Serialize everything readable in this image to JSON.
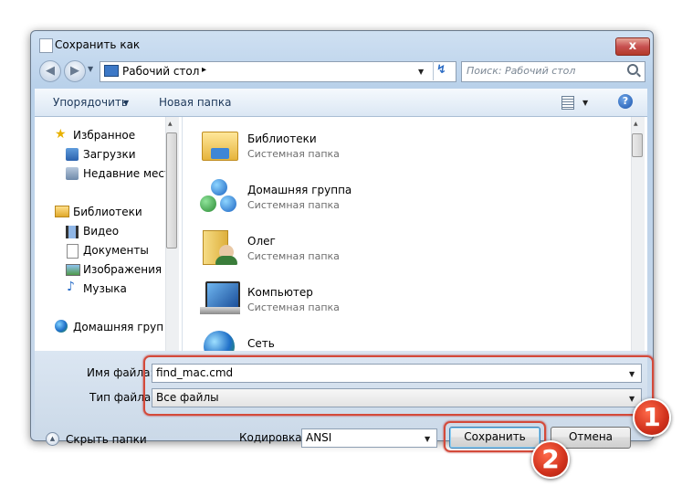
{
  "window": {
    "title": "Сохранить как",
    "close_label": "x"
  },
  "nav": {
    "back_icon": "back-arrow-icon",
    "forward_icon": "forward-arrow-icon"
  },
  "address": {
    "location": "Рабочий стол",
    "separator": "▸"
  },
  "search": {
    "placeholder": "Поиск: Рабочий стол"
  },
  "toolbar": {
    "organize": "Упорядочить",
    "new_folder": "Новая папка",
    "help": "?"
  },
  "sidebar": {
    "favorites": "Избранное",
    "downloads": "Загрузки",
    "recent": "Недавние места",
    "libraries": "Библиотеки",
    "video": "Видео",
    "documents": "Документы",
    "images": "Изображения",
    "music": "Музыка",
    "homegroup": "Домашняя группа"
  },
  "files": [
    {
      "name": "Библиотеки",
      "type": "Системная папка",
      "icon": "libraries-icon"
    },
    {
      "name": "Домашняя группа",
      "type": "Системная папка",
      "icon": "homegroup-icon"
    },
    {
      "name": "Олег",
      "type": "Системная папка",
      "icon": "user-folder-icon"
    },
    {
      "name": "Компьютер",
      "type": "Системная папка",
      "icon": "computer-icon"
    },
    {
      "name": "Сеть",
      "type": "",
      "icon": "network-icon"
    }
  ],
  "form": {
    "filename_label": "Имя файла:",
    "filename_value": "find_mac.cmd",
    "filetype_label": "Тип файла:",
    "filetype_value": "Все файлы"
  },
  "footer": {
    "hide_folders": "Скрыть папки",
    "encoding_label": "Кодировка:",
    "encoding_value": "ANSI",
    "save": "Сохранить",
    "cancel": "Отмена"
  },
  "callouts": {
    "one": "1",
    "two": "2"
  },
  "colors": {
    "accent_red": "#d44a3a",
    "toolbar_text": "#1e395b"
  }
}
